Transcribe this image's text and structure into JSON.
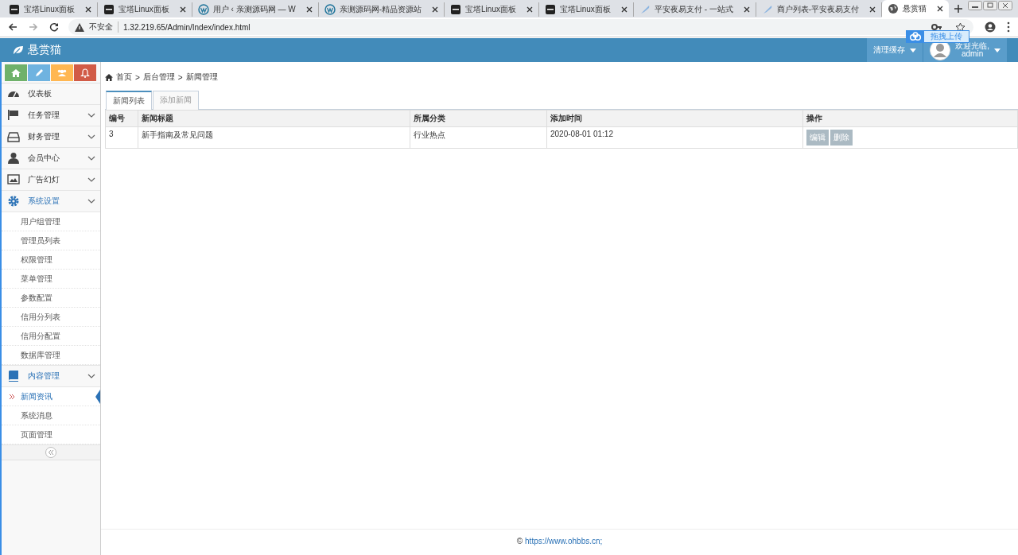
{
  "browser": {
    "tabs": [
      {
        "title": "宝塔Linux面板",
        "kind": "bt",
        "selected": false
      },
      {
        "title": "宝塔Linux面板",
        "kind": "bt",
        "selected": false
      },
      {
        "title": "用户 ‹ 亲测源码网 — W",
        "kind": "wp",
        "selected": false
      },
      {
        "title": "亲测源码网-精品资源站",
        "kind": "wp",
        "selected": false
      },
      {
        "title": "宝塔Linux面板",
        "kind": "bt",
        "selected": false
      },
      {
        "title": "宝塔Linux面板",
        "kind": "bt",
        "selected": false
      },
      {
        "title": "平安夜易支付 - 一站式",
        "kind": "link",
        "selected": false
      },
      {
        "title": "商户列表-平安夜易支付",
        "kind": "link",
        "selected": false
      },
      {
        "title": "悬赏猫",
        "kind": "globe",
        "selected": true
      }
    ],
    "security": "不安全",
    "url": "1.32.219.65/Admin/Index/index.html",
    "upload_label": "拖拽上传"
  },
  "header": {
    "brand": "悬赏猫",
    "clear_cache": "清理缓存",
    "welcome": "欢迎光临,",
    "user": "admin"
  },
  "sidebar": {
    "items": [
      {
        "label": "仪表板",
        "expanded": false
      },
      {
        "label": "任务管理",
        "expanded": false
      },
      {
        "label": "财务管理",
        "expanded": false
      },
      {
        "label": "会员中心",
        "expanded": false
      },
      {
        "label": "广告幻灯",
        "expanded": false
      },
      {
        "label": "系统设置",
        "expanded": true,
        "children": [
          {
            "label": "用户组管理",
            "selected": false
          },
          {
            "label": "管理员列表",
            "selected": false
          },
          {
            "label": "权限管理",
            "selected": false
          },
          {
            "label": "菜单管理",
            "selected": false
          },
          {
            "label": "参数配置",
            "selected": false
          },
          {
            "label": "信用分列表",
            "selected": false
          },
          {
            "label": "信用分配置",
            "selected": false
          },
          {
            "label": "数据库管理",
            "selected": false
          }
        ]
      },
      {
        "label": "内容管理",
        "expanded": true,
        "children": [
          {
            "label": "新闻资讯",
            "selected": true
          },
          {
            "label": "系统消息",
            "selected": false
          },
          {
            "label": "页面管理",
            "selected": false
          }
        ]
      }
    ]
  },
  "breadcrumb": {
    "items": [
      "首页",
      "后台管理",
      "新闻管理"
    ],
    "separator": ">"
  },
  "tabs": [
    {
      "label": "新闻列表",
      "selected": true
    },
    {
      "label": "添加新闻",
      "selected": false
    }
  ],
  "table": {
    "columns": [
      "编号",
      "新闻标题",
      "所属分类",
      "添加时间",
      "操作"
    ],
    "rows": [
      {
        "cells": [
          "3",
          "新手指南及常见问题",
          "行业热点",
          "2020-08-01 01:12"
        ],
        "actions": [
          "编辑",
          "删除"
        ]
      }
    ]
  },
  "footer": {
    "symbol": "©",
    "link": "https://www.ohbbs.cn;"
  }
}
